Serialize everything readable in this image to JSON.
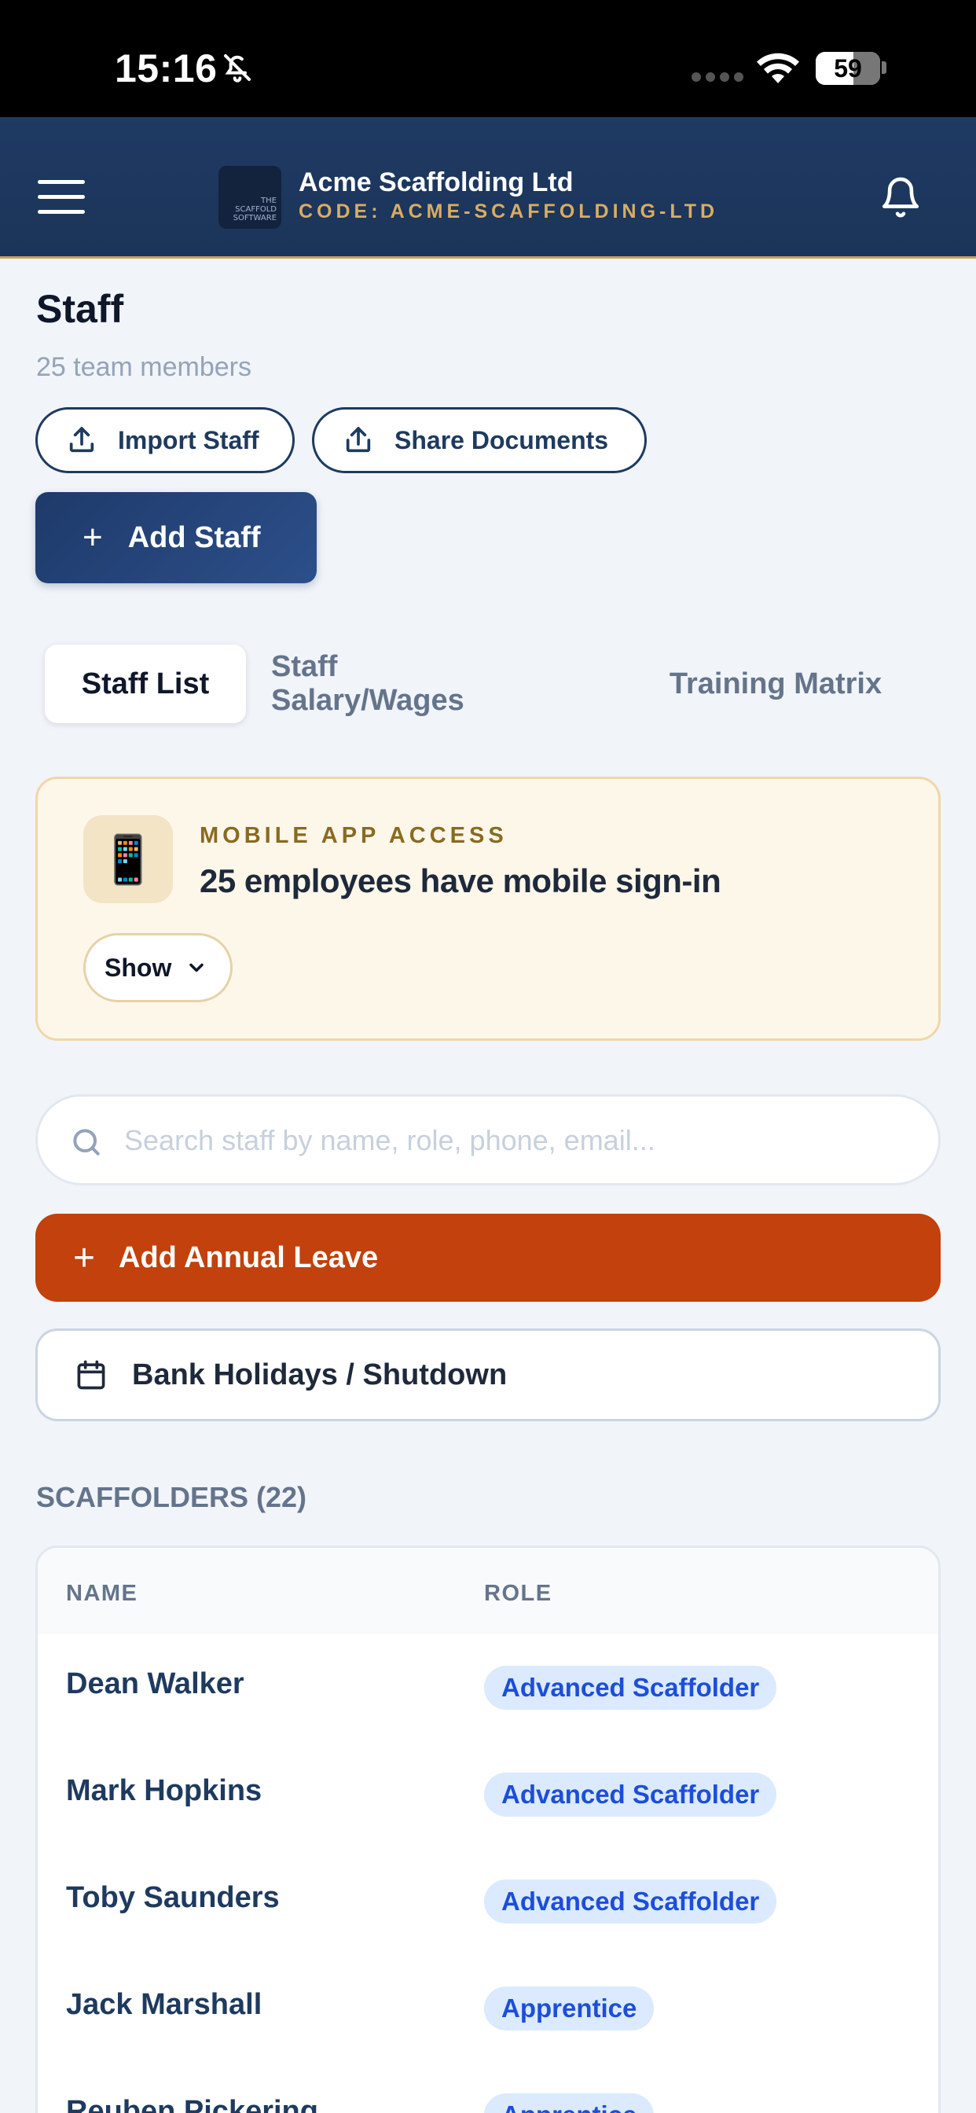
{
  "status_bar": {
    "time": "15:16",
    "battery": "59",
    "battery_level_percent": 59
  },
  "header": {
    "company_name": "Acme Scaffolding Ltd",
    "company_code": "CODE: ACME-SCAFFOLDING-LTD",
    "logo_text": "THE SCAFFOLD SOFTWARE"
  },
  "page": {
    "title": "Staff",
    "subtitle": "25 team members"
  },
  "actions": {
    "import_label": "Import Staff",
    "share_label": "Share Documents",
    "add_staff_label": "Add Staff",
    "add_annual_leave_label": "Add Annual Leave",
    "bank_holidays_label": "Bank Holidays / Shutdown"
  },
  "tabs": [
    {
      "label": "Staff List",
      "active": true
    },
    {
      "label": "Staff Salary/Wages",
      "active": false
    },
    {
      "label": "Training Matrix",
      "active": false
    }
  ],
  "mobile_access": {
    "label": "MOBILE APP ACCESS",
    "headline": "25 employees have mobile sign-in",
    "icon": "📱",
    "show_label": "Show"
  },
  "search": {
    "placeholder": "Search staff by name, role, phone, email...",
    "value": ""
  },
  "section": {
    "heading": "SCAFFOLDERS (22)"
  },
  "table": {
    "columns": [
      "NAME",
      "ROLE"
    ],
    "rows": [
      {
        "name": "Dean Walker",
        "role": "Advanced Scaffolder"
      },
      {
        "name": "Mark Hopkins",
        "role": "Advanced Scaffolder"
      },
      {
        "name": "Toby Saunders",
        "role": "Advanced Scaffolder"
      },
      {
        "name": "Jack Marshall",
        "role": "Apprentice"
      },
      {
        "name": "Reuben Pickering",
        "role": "Apprentice"
      }
    ]
  },
  "colors": {
    "brand_navy": "#1e3a5f",
    "accent_orange": "#c2410c",
    "gold": "#d9ad63",
    "badge_blue": "#1d4ed8"
  }
}
